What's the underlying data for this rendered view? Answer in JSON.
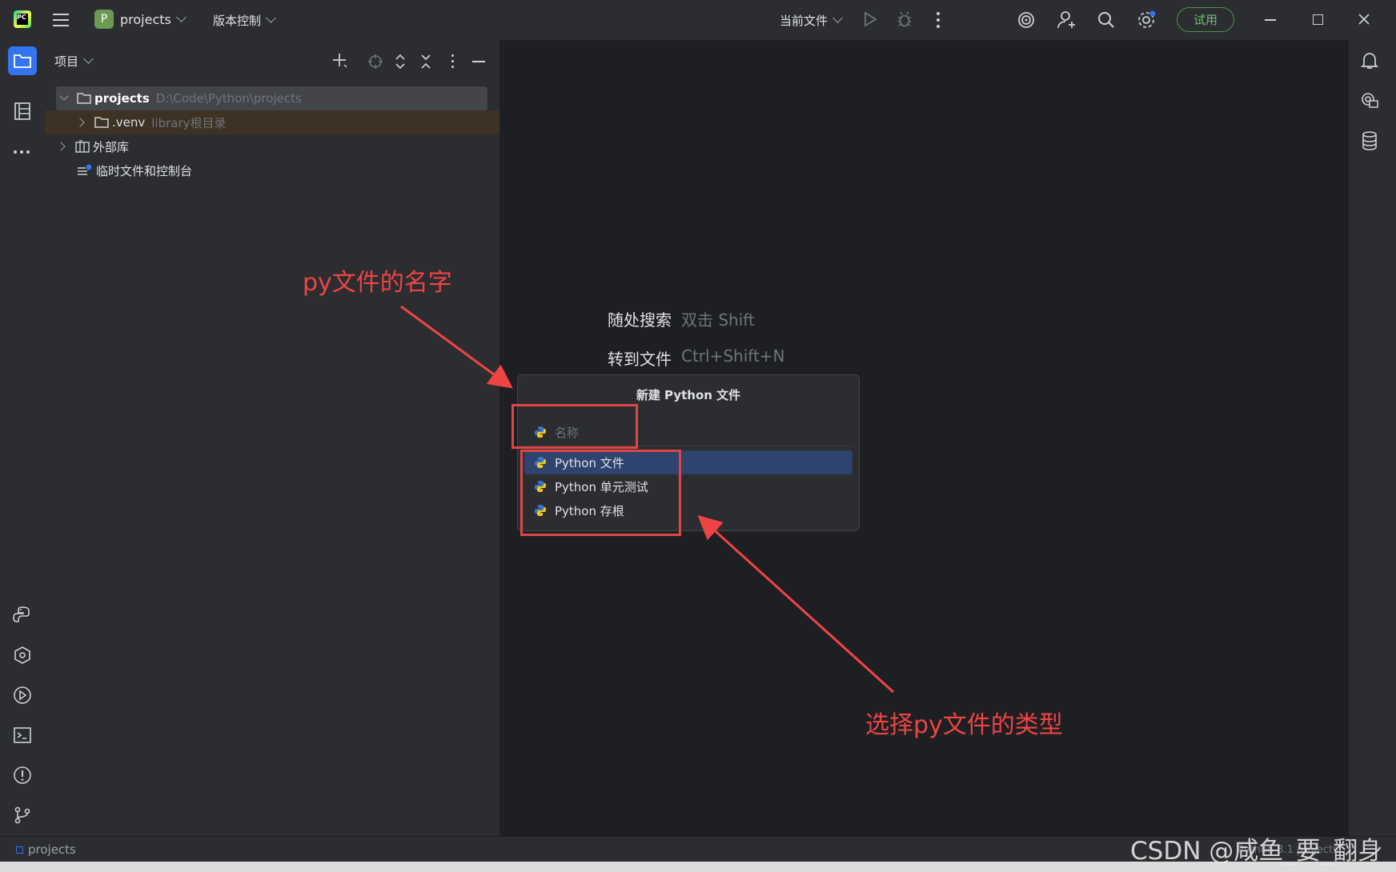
{
  "titlebar": {
    "project_badge": "P",
    "project_name": "projects",
    "vcs_label": "版本控制",
    "run_config": "当前文件",
    "trial_label": "试用"
  },
  "project_panel": {
    "header": "项目",
    "tree": [
      {
        "name": "projects",
        "path": "D:\\Code\\Python\\projects"
      },
      {
        "name": ".venv",
        "hint": "library根目录"
      },
      {
        "name": "外部库"
      },
      {
        "name": "临时文件和控制台"
      }
    ]
  },
  "editor": {
    "hints": [
      {
        "label": "随处搜索",
        "shortcut": "双击 Shift"
      },
      {
        "label": "转到文件",
        "shortcut": "Ctrl+Shift+N"
      }
    ]
  },
  "popup": {
    "title": "新建 Python 文件",
    "name_placeholder": "名称",
    "items": [
      "Python 文件",
      "Python 单元测试",
      "Python 存根"
    ]
  },
  "annotations": {
    "name_note": "py文件的名字",
    "type_note": "选择py文件的类型",
    "arrow_color": "#ef4444"
  },
  "statusbar": {
    "project": "projects",
    "right_text": "Python 3.1 projects"
  },
  "watermark": "CSDN @咸鱼_要_翻身",
  "colors": {
    "bg": "#2b2d30",
    "editor_bg": "#1e1f22",
    "selection": "#2e436e",
    "accent": "#3574f0"
  }
}
